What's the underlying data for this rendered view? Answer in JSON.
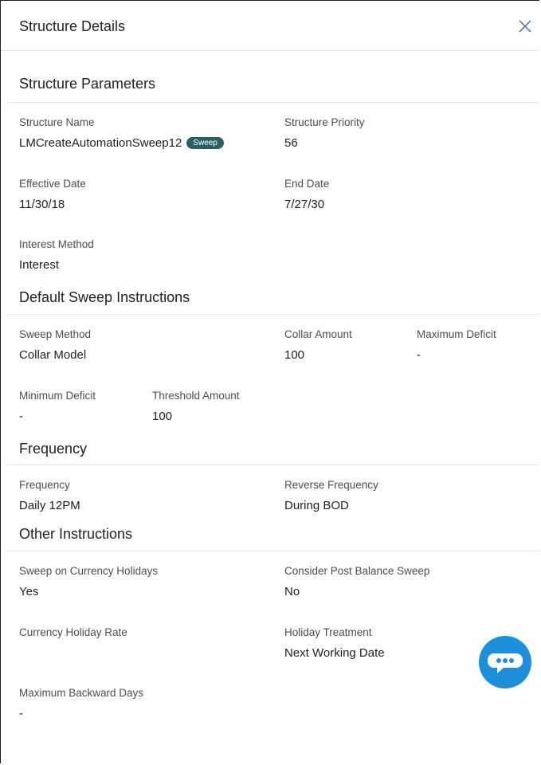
{
  "header": {
    "title": "Structure Details"
  },
  "sections": {
    "params": {
      "title": "Structure Parameters",
      "structure_name_label": "Structure Name",
      "structure_name_value": "LMCreateAutomationSweep12",
      "structure_badge": "Sweep",
      "priority_label": "Structure Priority",
      "priority_value": "56",
      "effective_label": "Effective Date",
      "effective_value": "11/30/18",
      "end_label": "End Date",
      "end_value": "7/27/30",
      "interest_label": "Interest Method",
      "interest_value": "Interest"
    },
    "sweep": {
      "title": "Default Sweep Instructions",
      "method_label": "Sweep Method",
      "method_value": "Collar Model",
      "collar_label": "Collar Amount",
      "collar_value": "100",
      "maxdef_label": "Maximum Deficit",
      "maxdef_value": "-",
      "mindef_label": "Minimum Deficit",
      "mindef_value": "-",
      "threshold_label": "Threshold Amount",
      "threshold_value": "100"
    },
    "frequency": {
      "title": "Frequency",
      "freq_label": "Frequency",
      "freq_value": "Daily 12PM",
      "rev_label": "Reverse Frequency",
      "rev_value": "During BOD"
    },
    "other": {
      "title": "Other Instructions",
      "holiday_sweep_label": "Sweep on Currency Holidays",
      "holiday_sweep_value": "Yes",
      "post_balance_label": "Consider Post Balance Sweep",
      "post_balance_value": "No",
      "holiday_rate_label": "Currency Holiday Rate",
      "holiday_rate_value": "",
      "holiday_treatment_label": "Holiday Treatment",
      "holiday_treatment_value": "Next Working Date",
      "max_back_label": "Maximum Backward Days",
      "max_back_value": "-"
    }
  },
  "icons": {
    "close": "close-icon",
    "chat": "chat-bubble-icon"
  },
  "colors": {
    "badge": "#2b5f62",
    "chat": "#1e8fd8",
    "divider": "#e6e6e6"
  }
}
